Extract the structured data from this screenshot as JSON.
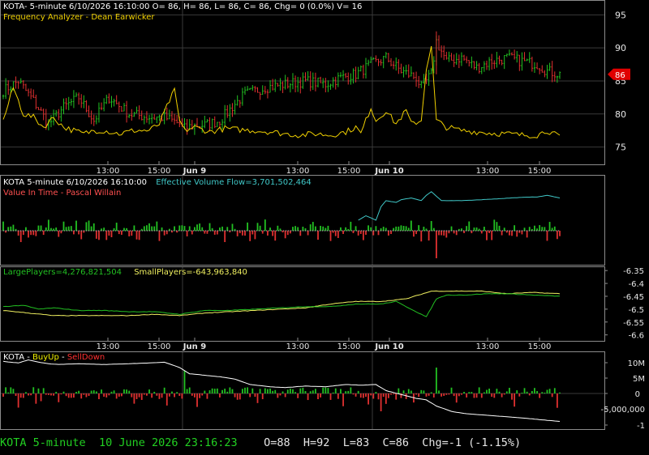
{
  "colors": {
    "background": "#000000",
    "frame": "#8c8c8c",
    "grid": "#3a3a3a",
    "up": "#22c022",
    "down": "#e03030",
    "price_header": "#ffffff",
    "freq_analyzer": "#f0d000",
    "vit_label": "#ff5050",
    "effective_volume": "#40c8c8",
    "large_players": "#22c022",
    "small_players": "#f0f060",
    "buyup": "#f0f000",
    "selldown": "#ff3030",
    "white": "#ffffff",
    "status_green": "#22d022",
    "price_tag_bg": "#e00000"
  },
  "panels": {
    "price": {
      "header": "KOTA- 5-minute 6/10/2026 16:10:00 O= 86, H= 86, L= 86, C= 86, Chg= 0 (0.0%) V= 16",
      "indicator_label": "Frequency Analyzer - Dean Earwicker",
      "current_price_tag": "86"
    },
    "volume": {
      "header_prefix": "KOTA 5-minute  6/10/2026 16:10:00",
      "header_evf": "Effective Volume Flow=3,701,502,464",
      "indicator_label": "Value In Time - Pascal Willain"
    },
    "players": {
      "large": "LargePlayers=4,276,821,504",
      "small": "SmallPlayers=-643,963,840"
    },
    "buyup": {
      "prefix": "KOTA - ",
      "buy": "BuyUp",
      "dash": "-",
      "sell": "SellDown"
    }
  },
  "status_bar": {
    "symbol": "KOTA",
    "interval": "5-minute",
    "datetime": "10 June 2026 23:16:23",
    "ohlc": "O=88  H=92  L=83  C=86  Chg=-1 (-1.15%)"
  },
  "chart_data": [
    {
      "type": "candlestick",
      "name": "price",
      "y_ticks": [
        75,
        80,
        85,
        90,
        95
      ],
      "ylim": [
        72.5,
        97
      ],
      "x_ticks": [
        "13:00",
        "15:00",
        "Jun 9",
        "13:00",
        "15:00",
        "Jun 10",
        "13:00",
        "15:00"
      ],
      "bar_count": 222,
      "current_price": 86,
      "close_anchors": [
        [
          0,
          83.5
        ],
        [
          6,
          85
        ],
        [
          12,
          82
        ],
        [
          18,
          78.5
        ],
        [
          24,
          81
        ],
        [
          30,
          82.5
        ],
        [
          36,
          79
        ],
        [
          42,
          82.5
        ],
        [
          50,
          80
        ],
        [
          58,
          79.5
        ],
        [
          64,
          79.5
        ],
        [
          70,
          78.5
        ],
        [
          72,
          77.8
        ],
        [
          76,
          78.3
        ],
        [
          80,
          78.3
        ],
        [
          86,
          79
        ],
        [
          92,
          81.5
        ],
        [
          96,
          83
        ],
        [
          104,
          84
        ],
        [
          112,
          84.5
        ],
        [
          120,
          85
        ],
        [
          128,
          84.5
        ],
        [
          134,
          85.5
        ],
        [
          140,
          86
        ],
        [
          146,
          87.5
        ],
        [
          152,
          88.5
        ],
        [
          158,
          86.5
        ],
        [
          164,
          85.5
        ],
        [
          166,
          84
        ],
        [
          170,
          86
        ],
        [
          172,
          91
        ],
        [
          176,
          88
        ],
        [
          182,
          88.5
        ],
        [
          188,
          87
        ],
        [
          194,
          88
        ],
        [
          200,
          88.5
        ],
        [
          206,
          88
        ],
        [
          212,
          87.5
        ],
        [
          216,
          86.5
        ],
        [
          221,
          86
        ]
      ]
    },
    {
      "type": "line",
      "name": "Frequency Analyzer",
      "ylim": [
        72.5,
        97
      ],
      "x_anchors": [
        [
          0,
          79
        ],
        [
          4,
          84
        ],
        [
          8,
          80
        ],
        [
          12,
          79.5
        ],
        [
          16,
          78
        ],
        [
          20,
          79.5
        ],
        [
          24,
          78
        ],
        [
          28,
          77.5
        ],
        [
          32,
          77
        ],
        [
          36,
          77.5
        ],
        [
          40,
          77.5
        ],
        [
          46,
          77
        ],
        [
          52,
          77.5
        ],
        [
          58,
          77.5
        ],
        [
          62,
          78.5
        ],
        [
          66,
          82
        ],
        [
          68,
          83.5
        ],
        [
          70,
          79
        ],
        [
          72,
          77.5
        ],
        [
          76,
          78
        ],
        [
          82,
          77.3
        ],
        [
          88,
          77.8
        ],
        [
          94,
          77.6
        ],
        [
          100,
          77.5
        ],
        [
          106,
          77.3
        ],
        [
          112,
          77
        ],
        [
          118,
          76.8
        ],
        [
          124,
          77
        ],
        [
          130,
          76.8
        ],
        [
          136,
          77.3
        ],
        [
          140,
          78
        ],
        [
          142,
          77
        ],
        [
          146,
          81
        ],
        [
          148,
          79
        ],
        [
          152,
          80.5
        ],
        [
          156,
          78.5
        ],
        [
          160,
          80.5
        ],
        [
          162,
          78.5
        ],
        [
          166,
          79
        ],
        [
          168,
          87
        ],
        [
          170,
          90
        ],
        [
          172,
          79
        ],
        [
          176,
          78
        ],
        [
          182,
          77.5
        ],
        [
          188,
          77.3
        ],
        [
          194,
          77.1
        ],
        [
          200,
          77
        ],
        [
          206,
          76.8
        ],
        [
          212,
          76.8
        ],
        [
          216,
          77.5
        ],
        [
          221,
          76.5
        ]
      ]
    },
    {
      "type": "line",
      "name": "Effective Volume Flow",
      "x_anchors": [
        [
          141,
          0.5
        ],
        [
          144,
          0.45
        ],
        [
          148,
          0.5
        ],
        [
          150,
          0.35
        ],
        [
          152,
          0.28
        ],
        [
          156,
          0.3
        ],
        [
          158,
          0.27
        ],
        [
          162,
          0.25
        ],
        [
          166,
          0.28
        ],
        [
          168,
          0.22
        ],
        [
          170,
          0.18
        ],
        [
          174,
          0.28
        ],
        [
          182,
          0.28
        ],
        [
          190,
          0.27
        ],
        [
          196,
          0.26
        ],
        [
          202,
          0.25
        ],
        [
          208,
          0.24
        ],
        [
          212,
          0.24
        ],
        [
          216,
          0.22
        ],
        [
          221,
          0.25
        ]
      ]
    },
    {
      "type": "line",
      "name": "LargePlayers",
      "ylim": [
        -6.62,
        -6.34
      ],
      "x_anchors": [
        [
          0,
          -6.49
        ],
        [
          8,
          -6.485
        ],
        [
          14,
          -6.5
        ],
        [
          20,
          -6.495
        ],
        [
          30,
          -6.505
        ],
        [
          40,
          -6.505
        ],
        [
          50,
          -6.51
        ],
        [
          60,
          -6.51
        ],
        [
          70,
          -6.52
        ],
        [
          80,
          -6.505
        ],
        [
          90,
          -6.505
        ],
        [
          100,
          -6.5
        ],
        [
          110,
          -6.495
        ],
        [
          120,
          -6.49
        ],
        [
          130,
          -6.49
        ],
        [
          140,
          -6.48
        ],
        [
          150,
          -6.48
        ],
        [
          156,
          -6.47
        ],
        [
          160,
          -6.49
        ],
        [
          164,
          -6.51
        ],
        [
          168,
          -6.53
        ],
        [
          172,
          -6.46
        ],
        [
          176,
          -6.445
        ],
        [
          184,
          -6.445
        ],
        [
          192,
          -6.44
        ],
        [
          200,
          -6.44
        ],
        [
          210,
          -6.445
        ],
        [
          221,
          -6.45
        ]
      ]
    },
    {
      "type": "line",
      "name": "SmallPlayers",
      "ylim": [
        -6.62,
        -6.34
      ],
      "x_anchors": [
        [
          0,
          -6.505
        ],
        [
          10,
          -6.515
        ],
        [
          20,
          -6.525
        ],
        [
          30,
          -6.525
        ],
        [
          40,
          -6.525
        ],
        [
          50,
          -6.525
        ],
        [
          60,
          -6.52
        ],
        [
          70,
          -6.525
        ],
        [
          80,
          -6.515
        ],
        [
          90,
          -6.51
        ],
        [
          100,
          -6.505
        ],
        [
          110,
          -6.5
        ],
        [
          120,
          -6.495
        ],
        [
          130,
          -6.48
        ],
        [
          140,
          -6.47
        ],
        [
          150,
          -6.47
        ],
        [
          160,
          -6.46
        ],
        [
          170,
          -6.43
        ],
        [
          180,
          -6.43
        ],
        [
          190,
          -6.43
        ],
        [
          200,
          -6.44
        ],
        [
          210,
          -6.435
        ],
        [
          221,
          -6.44
        ]
      ]
    },
    {
      "type": "line",
      "name": "BuyUp-SellDown",
      "y_ticks": [
        "10M",
        "5M",
        "0",
        "-5,000,000",
        "-1"
      ],
      "x_anchors": [
        [
          0,
          0.12
        ],
        [
          6,
          0.14
        ],
        [
          10,
          0.1
        ],
        [
          14,
          0.13
        ],
        [
          18,
          0.15
        ],
        [
          22,
          0.16
        ],
        [
          30,
          0.15
        ],
        [
          40,
          0.16
        ],
        [
          50,
          0.15
        ],
        [
          58,
          0.14
        ],
        [
          64,
          0.13
        ],
        [
          70,
          0.2
        ],
        [
          74,
          0.28
        ],
        [
          80,
          0.3
        ],
        [
          86,
          0.32
        ],
        [
          92,
          0.35
        ],
        [
          98,
          0.42
        ],
        [
          106,
          0.45
        ],
        [
          112,
          0.46
        ],
        [
          120,
          0.44
        ],
        [
          128,
          0.45
        ],
        [
          136,
          0.42
        ],
        [
          142,
          0.43
        ],
        [
          148,
          0.42
        ],
        [
          152,
          0.5
        ],
        [
          158,
          0.55
        ],
        [
          164,
          0.6
        ],
        [
          168,
          0.62
        ],
        [
          172,
          0.7
        ],
        [
          178,
          0.77
        ],
        [
          184,
          0.8
        ],
        [
          192,
          0.82
        ],
        [
          200,
          0.84
        ],
        [
          208,
          0.86
        ],
        [
          214,
          0.88
        ],
        [
          221,
          0.9
        ]
      ]
    }
  ]
}
